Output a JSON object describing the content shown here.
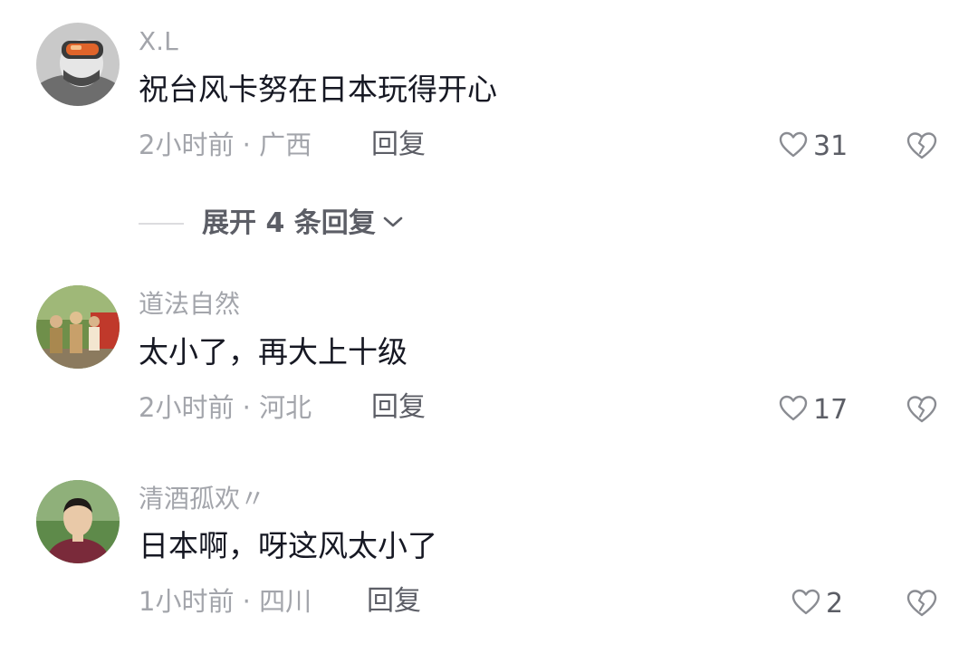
{
  "comments": [
    {
      "username": "X.L",
      "text": "祝台风卡努在日本玩得开心",
      "meta": "2小时前 · 广西",
      "reply_label": "回复",
      "likes": "31",
      "avatar": "avatar-skier-goggles"
    },
    {
      "username": "道法自然",
      "text": "太小了，再大上十级",
      "meta": "2小时前 · 河北",
      "reply_label": "回复",
      "likes": "17",
      "avatar": "avatar-outdoor-group"
    },
    {
      "username": "清酒孤欢〃",
      "text": "日本啊，呀这风太小了",
      "meta": "1小时前 · 四川",
      "reply_label": "回复",
      "likes": "2",
      "avatar": "avatar-man-portrait"
    }
  ],
  "expand_replies": {
    "label": "展开 4 条回复"
  },
  "icons": {
    "like": "heart-outline-icon",
    "dislike": "broken-heart-icon",
    "expand": "chevron-down-icon"
  },
  "colors": {
    "text_primary": "#161823",
    "text_secondary": "#a3a5ab",
    "text_action": "#5c5e66"
  }
}
